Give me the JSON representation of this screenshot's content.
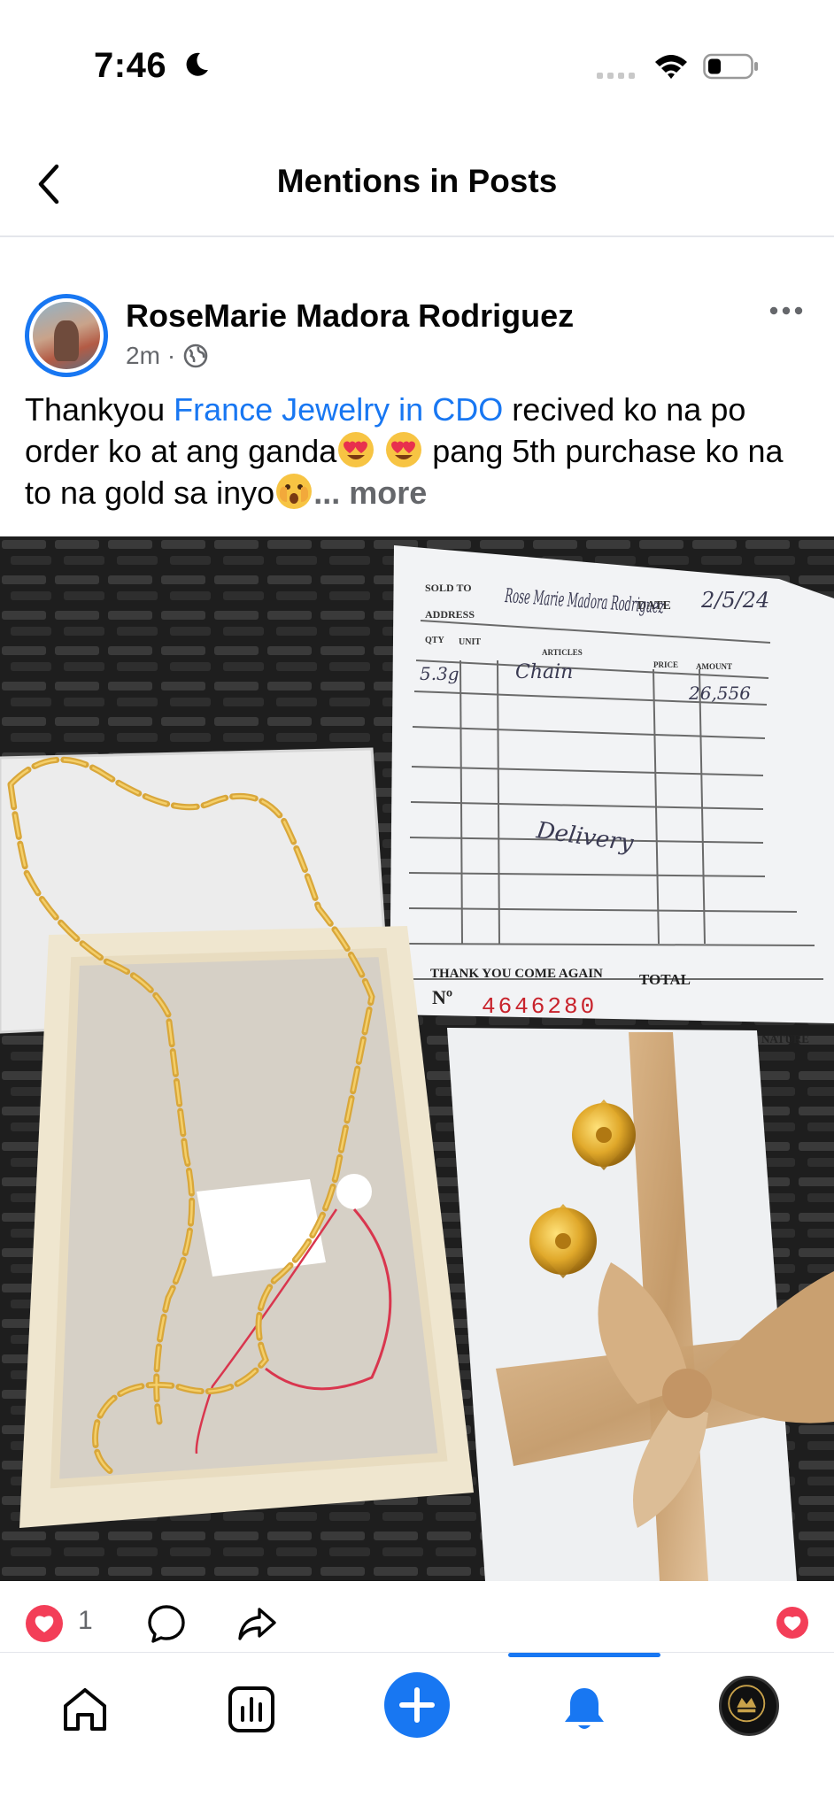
{
  "status_bar": {
    "time": "7:46",
    "icons": [
      "moon-icon",
      "signal-icon",
      "wifi-icon",
      "battery-icon"
    ]
  },
  "header": {
    "title": "Mentions in Posts",
    "back_icon": "chevron-left-icon"
  },
  "post": {
    "author": "RoseMarie Madora Rodriguez",
    "time": "2m",
    "separator": "·",
    "privacy_icon": "globe-icon",
    "text_before": "Thankyou ",
    "mention": "France Jewelry in CDO",
    "text_after_1": " recived ko na po order ko at ang ganda",
    "text_after_2": " pang 5th purchase ko na to na gold sa inyo",
    "ellipsis": "... ",
    "more": "more",
    "emojis": [
      "heart-eyes-emoji",
      "heart-eyes-emoji",
      "peeking-emoji"
    ]
  },
  "photo": {
    "receipt": {
      "sold_to": "SOLD TO",
      "address": "ADDRESS",
      "qty": "QTY",
      "unit": "UNIT",
      "articles": "ARTICLES",
      "price": "PRICE",
      "amount": "AMOUNT",
      "date": "DATE",
      "date_value": "2/5/24",
      "name_value": "Rose Marie Madora Rodriguez",
      "qty_value": "5.3g",
      "article_value": "Chain",
      "amount_value": "26,556",
      "note_value": "Delivery",
      "thank_you": "THANK YOU COME AGAIN",
      "total": "TOTAL",
      "number_prefix": "Nº",
      "number": "4646280",
      "signature": "NATURE"
    }
  },
  "actions": {
    "reactions_count": "1"
  },
  "tabbar": {
    "items": [
      "home",
      "feeds",
      "create",
      "notifications",
      "profile"
    ],
    "active": "notifications",
    "accent": "#1877f2"
  }
}
